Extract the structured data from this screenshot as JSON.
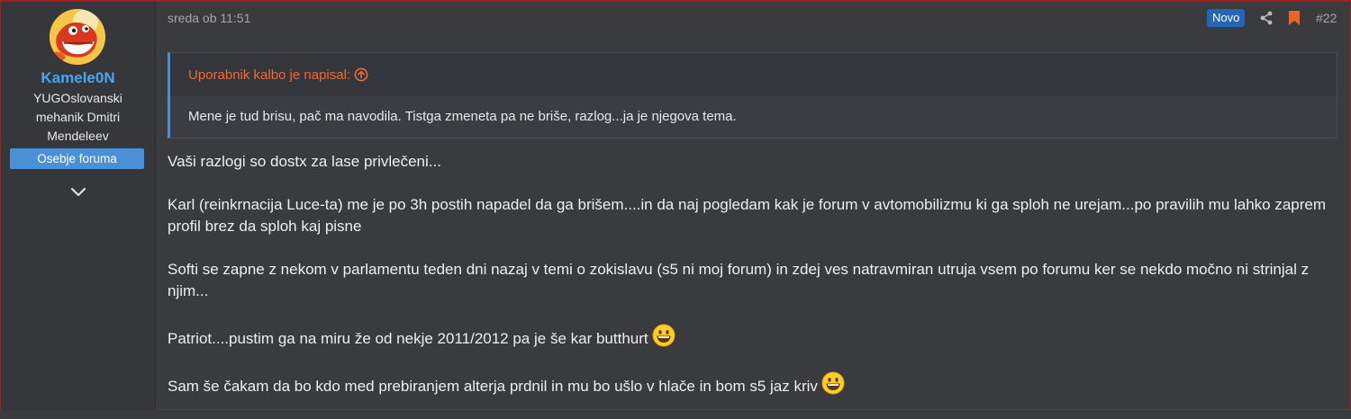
{
  "user": {
    "name": "Kamele0N",
    "title": "YUGOslovanski mehanik Dmitri Mendeleev",
    "banner": "Osebje foruma"
  },
  "post": {
    "date": "sreda ob 11:51",
    "badge": "Novo",
    "number": "#22",
    "quote": {
      "attribution": "Uporabnik kalbo je napisal:",
      "text": "Mene je tud brisu, pač ma navodila. Tistga zmeneta pa ne briše, razlog...ja je njegova tema."
    },
    "paragraphs": [
      "Vaši razlogi so dostx za lase privlečeni...",
      "Karl (reinkrnacija Luce-ta) me je po 3h postih napadel da ga brišem....in da naj pogledam kak je forum v avtomobilizmu ki ga sploh ne urejam...po pravilih mu lahko zaprem profil brez da sploh kaj pisne",
      "Softi se zapne z nekom v parlamentu teden dni nazaj v temi o zokislavu (s5 ni moj forum) in zdej ves natravmiran utruja vsem po forumu ker se nekdo močno ni strinjal z njim...",
      "Patriot....pustim ga na miru že od nekje 2011/2012 pa je še kar butthurt",
      "Sam še čakam da bo kdo med prebiranjem alterja prdnil in mu bo ušlo v hlače in bom s5 jaz kriv"
    ]
  },
  "icons": {
    "share": "share-icon",
    "bookmark": "bookmark-icon",
    "expand": "chevron-down-icon",
    "quote_jump": "arrow-up-circle-icon",
    "emoji": "grinning-face-icon"
  },
  "colors": {
    "accent": "#4b8fd6",
    "username": "#4ca5f0",
    "quote_attribution": "#ef6a34",
    "bookmark": "#f06423",
    "badge_new": "#2366b3"
  }
}
